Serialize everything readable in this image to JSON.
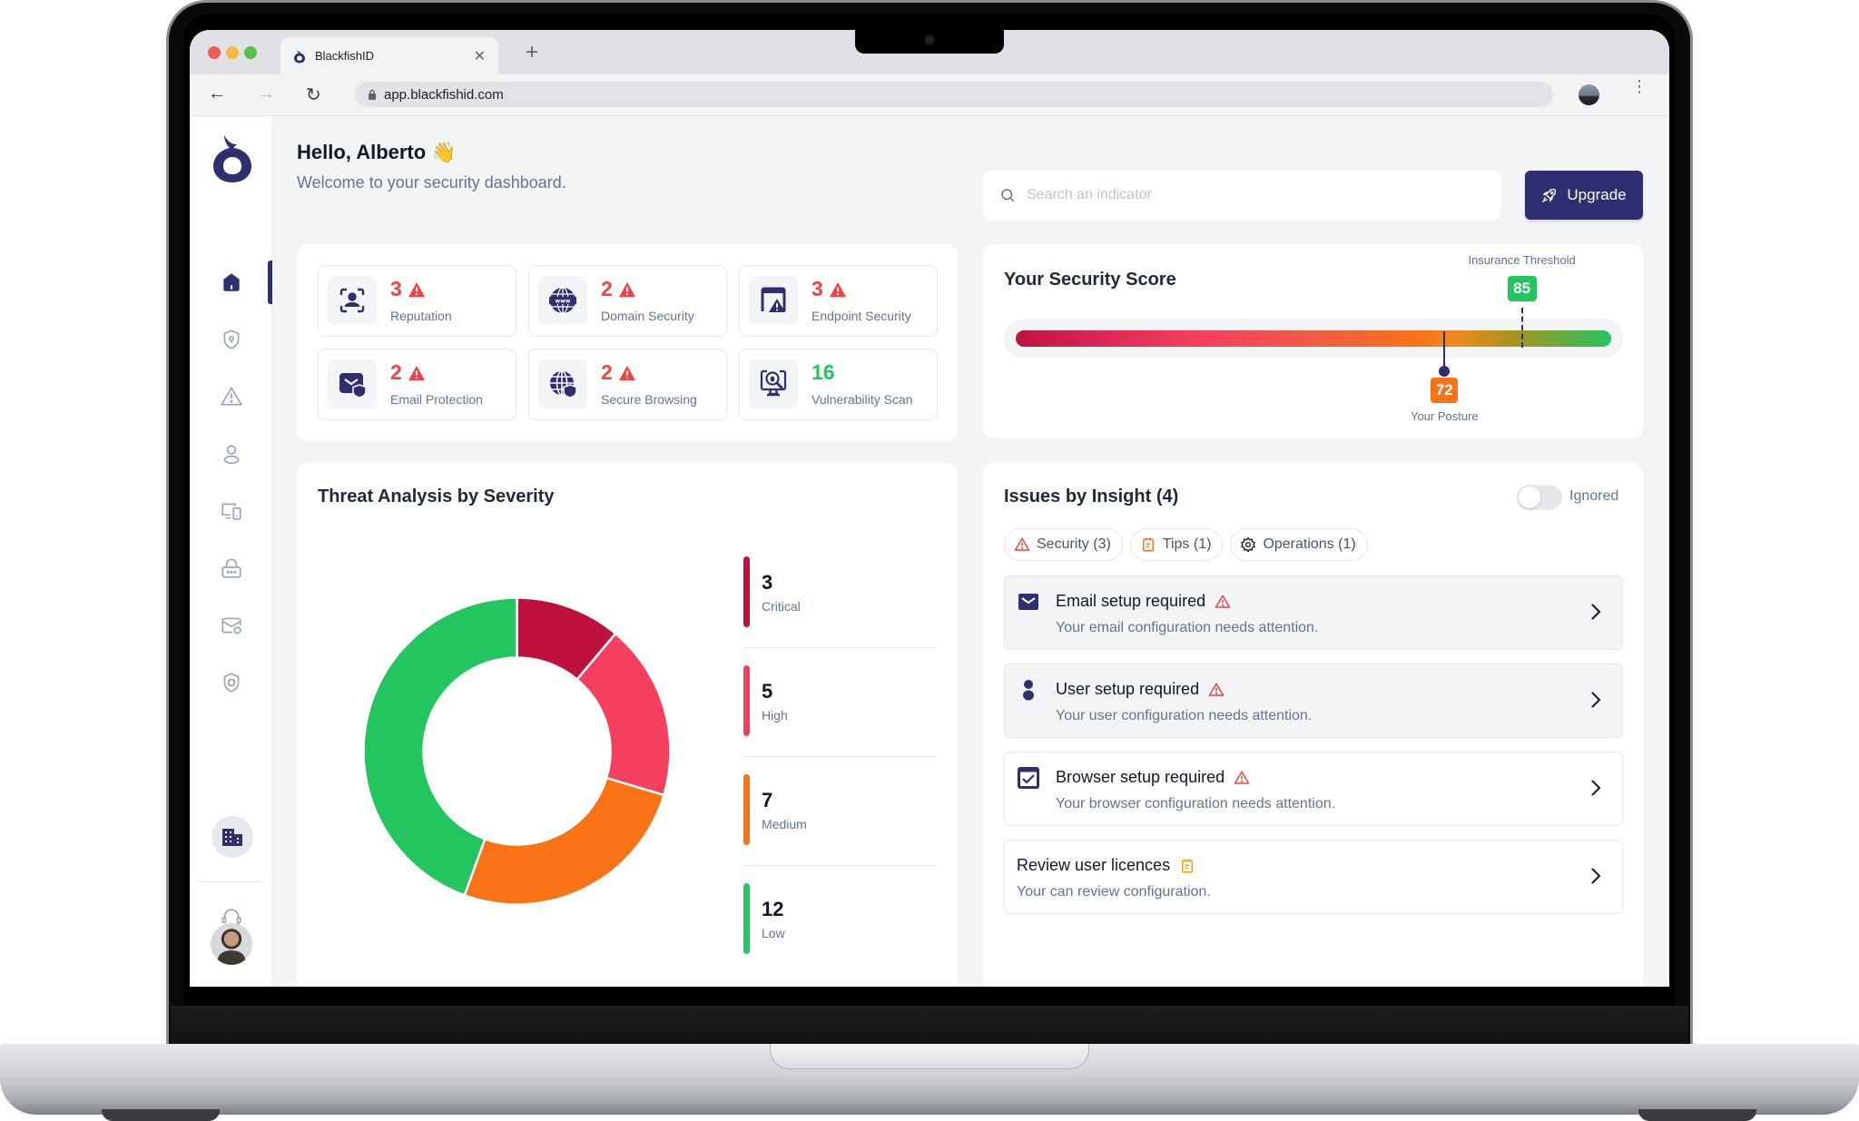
{
  "browser": {
    "tab_title": "BlackfishID",
    "url": "app.blackfishid.com",
    "icons": [
      "back-icon",
      "forward-icon",
      "reload-icon",
      "lock-icon",
      "profile-icon",
      "kebab-menu-icon",
      "close-tab-icon",
      "new-tab-icon"
    ]
  },
  "header": {
    "greeting": "Hello, Alberto",
    "greeting_emoji": "👋",
    "subtitle": "Welcome to your security dashboard.",
    "search_placeholder": "Search an indicator",
    "search_value": "",
    "upgrade_label": "Upgrade"
  },
  "sidebar": {
    "items": [
      {
        "name": "home",
        "icon": "home-icon",
        "active": true
      },
      {
        "name": "shield",
        "icon": "shield-lock-icon",
        "active": false
      },
      {
        "name": "alerts",
        "icon": "warning-icon",
        "active": false
      },
      {
        "name": "users",
        "icon": "user-icon",
        "active": false
      },
      {
        "name": "devices",
        "icon": "devices-icon",
        "active": false
      },
      {
        "name": "passwords",
        "icon": "password-lock-icon",
        "active": false
      },
      {
        "name": "email",
        "icon": "email-shield-icon",
        "active": false
      },
      {
        "name": "vulnerabilities",
        "icon": "bug-shield-icon",
        "active": false
      }
    ],
    "bottom": [
      "organization-icon",
      "support-headset-icon",
      "user-avatar"
    ]
  },
  "stats": [
    {
      "value": "3",
      "label": "Reputation",
      "status": "warning"
    },
    {
      "value": "2",
      "label": "Domain Security",
      "status": "warning"
    },
    {
      "value": "3",
      "label": "Endpoint Security",
      "status": "warning"
    },
    {
      "value": "2",
      "label": "Email Protection",
      "status": "warning"
    },
    {
      "value": "2",
      "label": "Secure Browsing",
      "status": "warning"
    },
    {
      "value": "16",
      "label": "Vulnerability Scan",
      "status": "ok"
    }
  ],
  "score": {
    "title": "Your Security Score",
    "threshold_label": "Insurance Threshold",
    "threshold_value": 85,
    "posture_label": "Your Posture",
    "posture_value": 72,
    "scale_max": 100
  },
  "chart_data": {
    "type": "pie",
    "title": "Threat Analysis by Severity",
    "categories": [
      "Critical",
      "High",
      "Medium",
      "Low"
    ],
    "values": [
      3,
      5,
      7,
      12
    ],
    "colors": [
      "#be123c",
      "#f43f5e",
      "#f97316",
      "#22c55e"
    ],
    "donut": true,
    "legend_placement": "right"
  },
  "threat": {
    "legend": [
      {
        "value": "3",
        "label": "Critical"
      },
      {
        "value": "5",
        "label": "High"
      },
      {
        "value": "7",
        "label": "Medium"
      },
      {
        "value": "12",
        "label": "Low"
      }
    ]
  },
  "issues": {
    "title": "Issues by Insight (4)",
    "toggle_label": "Ignored",
    "toggle_on": false,
    "filters": [
      {
        "label": "Security (3)",
        "icon": "warning-icon"
      },
      {
        "label": "Tips (1)",
        "icon": "notepad-icon"
      },
      {
        "label": "Operations (1)",
        "icon": "gear-icon"
      }
    ],
    "items": [
      {
        "title": "Email setup required",
        "description": "Your email configuration needs attention.",
        "icon": "email-icon",
        "badge": "warning-icon"
      },
      {
        "title": "User setup required",
        "description": "Your user configuration needs attention.",
        "icon": "user-icon",
        "badge": "warning-icon"
      },
      {
        "title": "Browser setup required",
        "description": "Your browser configuration needs attention.",
        "icon": "browser-check-icon",
        "badge": "warning-icon"
      },
      {
        "title": "Review user licences",
        "description": "Your can review configuration.",
        "icon": "",
        "badge": "notepad-icon"
      }
    ]
  },
  "colors": {
    "brand": "#2d2f70",
    "danger": "#ef4444",
    "success": "#22c55e",
    "warning": "#f97316",
    "critical": "#be123c",
    "high": "#f43f5e"
  }
}
